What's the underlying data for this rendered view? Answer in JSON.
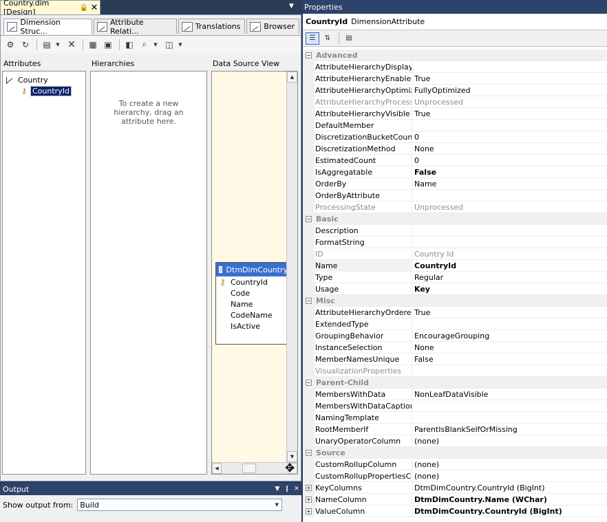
{
  "designer": {
    "doc_tab": "Country.dim [Design]",
    "tabs": [
      {
        "label": "Dimension Struc..."
      },
      {
        "label": "Attribute Relati..."
      },
      {
        "label": "Translations"
      },
      {
        "label": "Browser"
      }
    ],
    "attributes_header": "Attributes",
    "hierarchies_header": "Hierarchies",
    "dsv_header": "Data Source View",
    "dimension_name": "Country",
    "selected_attribute": "CountryId",
    "hierarchy_hint": "To create a new hierarchy, drag an attribute here.",
    "table": {
      "name": "DtmDimCountry",
      "columns": [
        "CountryId",
        "Code",
        "Name",
        "CodeName",
        "IsActive"
      ]
    }
  },
  "output": {
    "title": "Output",
    "show_label": "Show output from:",
    "source": "Build"
  },
  "properties": {
    "title": "Properties",
    "object_name": "CountryId",
    "object_type": "DimensionAttribute",
    "categories": [
      {
        "name": "Advanced",
        "rows": [
          {
            "name": "AttributeHierarchyDisplayFolder",
            "value": ""
          },
          {
            "name": "AttributeHierarchyEnabled",
            "value": "True"
          },
          {
            "name": "AttributeHierarchyOptimizedState",
            "value": "FullyOptimized"
          },
          {
            "name": "AttributeHierarchyProcessingState",
            "value": "Unprocessed",
            "grey": true
          },
          {
            "name": "AttributeHierarchyVisible",
            "value": "True"
          },
          {
            "name": "DefaultMember",
            "value": ""
          },
          {
            "name": "DiscretizationBucketCount",
            "value": "0"
          },
          {
            "name": "DiscretizationMethod",
            "value": "None"
          },
          {
            "name": "EstimatedCount",
            "value": "0"
          },
          {
            "name": "IsAggregatable",
            "value": "False",
            "bold": true
          },
          {
            "name": "OrderBy",
            "value": "Name"
          },
          {
            "name": "OrderByAttribute",
            "value": ""
          },
          {
            "name": "ProcessingState",
            "value": "Unprocessed",
            "grey": true
          }
        ]
      },
      {
        "name": "Basic",
        "rows": [
          {
            "name": "Description",
            "value": ""
          },
          {
            "name": "FormatString",
            "value": ""
          },
          {
            "name": "ID",
            "value": "Country Id",
            "grey": true
          },
          {
            "name": "Name",
            "value": "CountryId",
            "bold": true,
            "sel": true
          },
          {
            "name": "Type",
            "value": "Regular"
          },
          {
            "name": "Usage",
            "value": "Key",
            "bold": true
          }
        ]
      },
      {
        "name": "Misc",
        "rows": [
          {
            "name": "AttributeHierarchyOrdered",
            "value": "True"
          },
          {
            "name": "ExtendedType",
            "value": ""
          },
          {
            "name": "GroupingBehavior",
            "value": "EncourageGrouping"
          },
          {
            "name": "InstanceSelection",
            "value": "None"
          },
          {
            "name": "MemberNamesUnique",
            "value": "False"
          },
          {
            "name": "VisualizationProperties",
            "value": "",
            "grey": true
          }
        ]
      },
      {
        "name": "Parent-Child",
        "rows": [
          {
            "name": "MembersWithData",
            "value": "NonLeafDataVisible"
          },
          {
            "name": "MembersWithDataCaption",
            "value": ""
          },
          {
            "name": "NamingTemplate",
            "value": ""
          },
          {
            "name": "RootMemberIf",
            "value": "ParentIsBlankSelfOrMissing"
          },
          {
            "name": "UnaryOperatorColumn",
            "value": "(none)"
          }
        ]
      },
      {
        "name": "Source",
        "rows": [
          {
            "name": "CustomRollupColumn",
            "value": "(none)"
          },
          {
            "name": "CustomRollupPropertiesColumn",
            "value": "(none)"
          },
          {
            "name": "KeyColumns",
            "value": "DtmDimCountry.CountryId (BigInt)",
            "expand": true
          },
          {
            "name": "NameColumn",
            "value": "DtmDimCountry.Name (WChar)",
            "expand": true,
            "bold": true
          },
          {
            "name": "ValueColumn",
            "value": "DtmDimCountry.CountryId (BigInt)",
            "expand": true,
            "bold": true
          }
        ]
      }
    ]
  }
}
